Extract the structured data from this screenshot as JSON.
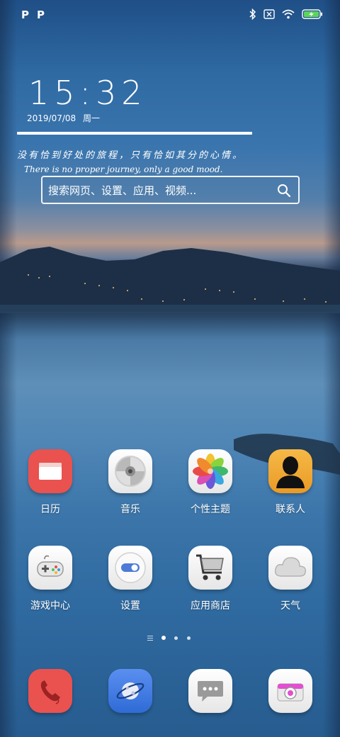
{
  "status_bar": {
    "left_icons": [
      "P",
      "P"
    ],
    "right_icons": [
      "bluetooth-icon",
      "sim-off-icon",
      "wifi-icon",
      "battery-charging-icon"
    ]
  },
  "clock": {
    "time": "15:32",
    "date": "2019/07/08",
    "weekday": "周一"
  },
  "quote": {
    "chinese": "没有恰到好处的旅程，只有恰如其分的心情。",
    "english": "There is no proper journey, only a good mood."
  },
  "search": {
    "placeholder": "搜索网页、设置、应用、视频..."
  },
  "apps_row1": [
    {
      "label": "日历",
      "icon": "calendar-icon"
    },
    {
      "label": "音乐",
      "icon": "music-disc-icon"
    },
    {
      "label": "个性主题",
      "icon": "theme-flower-icon"
    },
    {
      "label": "联系人",
      "icon": "contact-person-icon"
    }
  ],
  "apps_row2": [
    {
      "label": "游戏中心",
      "icon": "gamepad-icon"
    },
    {
      "label": "设置",
      "icon": "toggle-settings-icon"
    },
    {
      "label": "应用商店",
      "icon": "shopping-cart-icon"
    },
    {
      "label": "天气",
      "icon": "cloud-icon"
    }
  ],
  "page_indicator": {
    "pages": 4,
    "current": 2
  },
  "dock": [
    {
      "icon": "phone-icon"
    },
    {
      "icon": "browser-planet-icon"
    },
    {
      "icon": "message-icon"
    },
    {
      "icon": "camera-icon"
    }
  ],
  "colors": {
    "calendar_red": "#e9524f",
    "contacts_orange": "#f2a938",
    "browser_blue": "#3a7be0",
    "phone_red": "#e9524f",
    "camera_pink": "#e24fd0"
  }
}
